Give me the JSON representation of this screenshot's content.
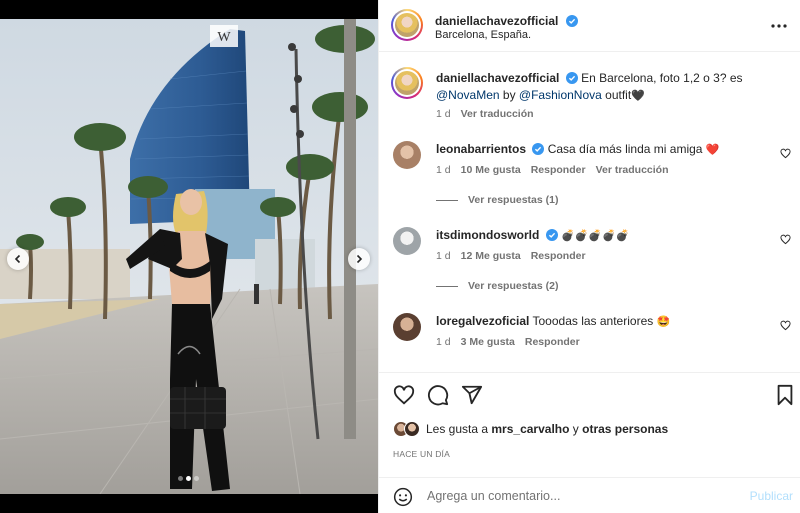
{
  "post": {
    "username": "daniellachavezofficial",
    "location": "Barcelona, España.",
    "caption_text_1": "En Barcelona, foto 1,2 o 3? es",
    "caption_mention_1": "@NovaMen",
    "caption_by": "by",
    "caption_mention_2": "@FashionNova",
    "caption_text_2": "outfit",
    "caption_emoji": "🖤",
    "caption_time": "1 d",
    "caption_translate": "Ver traducción"
  },
  "comments": [
    {
      "username": "leonabarrientos",
      "verified": true,
      "text": "Casa día más linda mi amiga",
      "emoji": "❤️",
      "time": "1 d",
      "likes": "10 Me gusta",
      "reply": "Responder",
      "translate": "Ver traducción",
      "replies": "Ver respuestas (1)"
    },
    {
      "username": "itsdimondosworld",
      "verified": true,
      "text": "",
      "emoji": "💣💣💣💣💣",
      "time": "1 d",
      "likes": "12 Me gusta",
      "reply": "Responder",
      "replies": "Ver respuestas (2)"
    },
    {
      "username": "loregalvezoficial",
      "verified": false,
      "text": "Tooodas las anteriores",
      "emoji": "🤩",
      "time": "1 d",
      "likes": "3 Me gusta",
      "reply": "Responder"
    }
  ],
  "likes_summary": {
    "prefix": "Les gusta a",
    "user": "mrs_carvalho",
    "middle": "y",
    "others": "otras personas"
  },
  "timestamp": "HACE UN DÍA",
  "composer": {
    "placeholder": "Agrega un comentario...",
    "publish_label": "Publicar"
  },
  "carousel": {
    "slide_count": 3,
    "active_index": 1
  },
  "colors": {
    "verified": "#3897f0",
    "link": "#00376b",
    "muted": "#737373",
    "publish_disabled": "#b2dffc"
  },
  "icons": [
    "chevron-left-icon",
    "chevron-right-icon",
    "more-icon",
    "heart-icon",
    "comment-icon",
    "share-icon",
    "bookmark-icon",
    "smile-icon",
    "verified-icon"
  ]
}
